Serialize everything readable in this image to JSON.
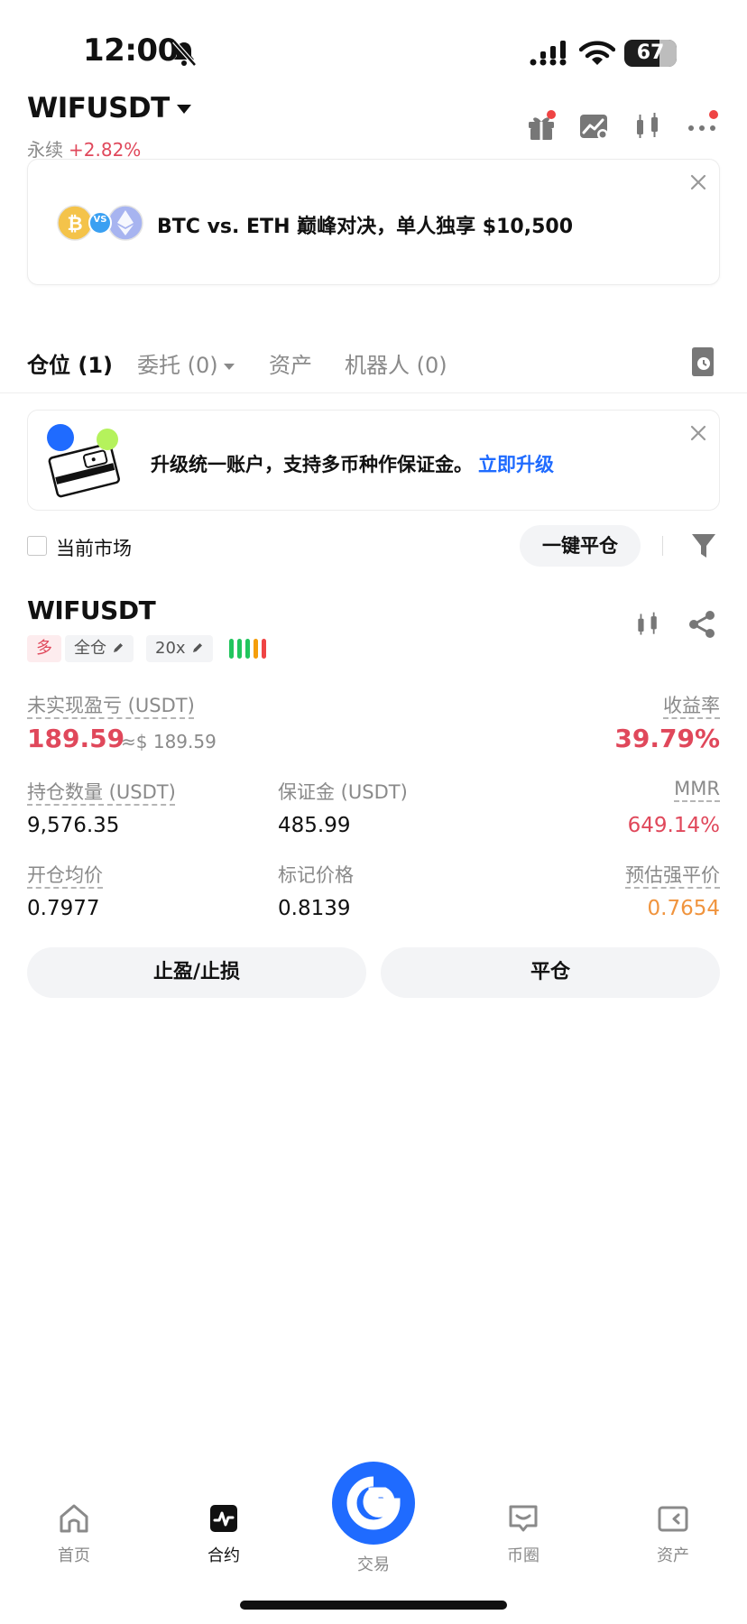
{
  "status_bar": {
    "time": "12:00",
    "battery": "67",
    "battery_level": 0.67
  },
  "header": {
    "symbol": "WIFUSDT",
    "contract_type": "永续",
    "change": "+2.82%"
  },
  "promo": {
    "text": "BTC vs. ETH 巅峰对决，单人独享 $10,500",
    "coin_badge": "VS"
  },
  "tabs": [
    {
      "label": "仓位 (1)",
      "active": true
    },
    {
      "label": "委托 (0)",
      "active": false
    },
    {
      "label": "资产",
      "active": false
    },
    {
      "label": "机器人 (0)",
      "active": false
    }
  ],
  "upgrade_banner": {
    "text": "升级统一账户，支持多币种作保证金。",
    "link": "立即升级"
  },
  "filter": {
    "current_market_label": "当前市场",
    "close_all_label": "一键平仓"
  },
  "position": {
    "symbol": "WIFUSDT",
    "side": "多",
    "margin_mode": "全仓",
    "leverage": "20x",
    "unrealized_pnl_label": "未实现盈亏 (USDT)",
    "unrealized_pnl": "189.59",
    "unrealized_pnl_usd": "≈$ 189.59",
    "roi_label": "收益率",
    "roi": "39.79%",
    "size_label": "持仓数量 (USDT)",
    "size": "9,576.35",
    "margin_label": "保证金 (USDT)",
    "margin": "485.99",
    "mmr_label": "MMR",
    "mmr": "649.14%",
    "entry_label": "开仓均价",
    "entry_price": "0.7977",
    "mark_label": "标记价格",
    "mark_price": "0.8139",
    "liq_label": "预估强平价",
    "liq_price": "0.7654",
    "tpsl_button": "止盈/止损",
    "close_button": "平仓"
  },
  "colors": {
    "accent": "#1f6bff",
    "positive_red": "#e0485b",
    "warning_orange": "#f0943e",
    "risk_bars": [
      "#22c55e",
      "#22c55e",
      "#22c55e",
      "#f59e0b",
      "#ef4444"
    ]
  },
  "bottom_nav": [
    {
      "label": "首页",
      "icon": "home-icon",
      "active": false
    },
    {
      "label": "合约",
      "icon": "futures-icon",
      "active": true
    },
    {
      "label": "交易",
      "icon": "trade-icon",
      "active": false
    },
    {
      "label": "币圈",
      "icon": "feed-icon",
      "active": false
    },
    {
      "label": "资产",
      "icon": "wallet-icon",
      "active": false
    }
  ]
}
